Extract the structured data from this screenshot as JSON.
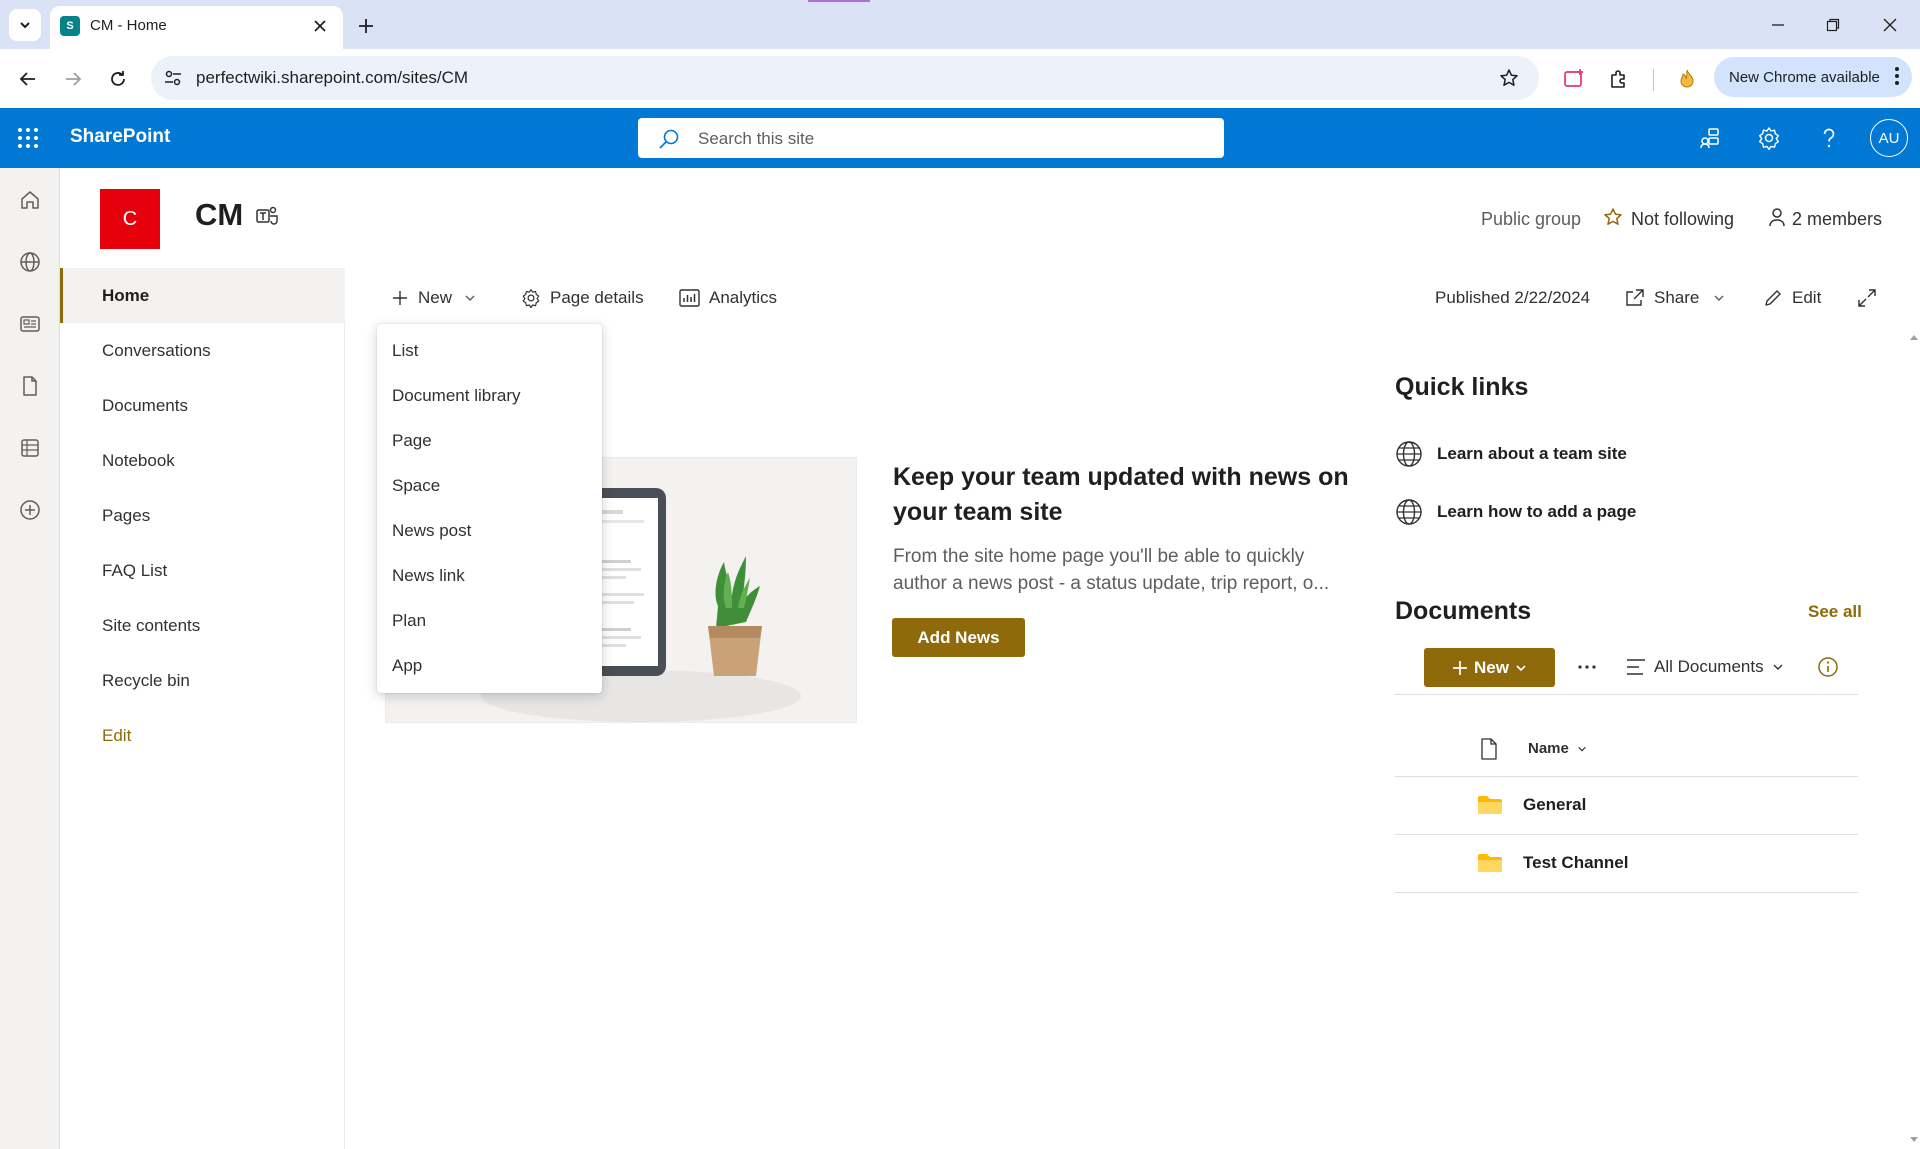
{
  "browser": {
    "tab_title": "CM - Home",
    "tab_favicon_letter": "S",
    "url": "perfectwiki.sharepoint.com/sites/CM",
    "update_label": "New Chrome available"
  },
  "suite": {
    "brand": "SharePoint",
    "search_placeholder": "Search this site",
    "avatar_initials": "AU"
  },
  "site": {
    "logo_letter": "C",
    "title": "CM",
    "group_type": "Public group",
    "follow_label": "Not following",
    "members_label": "2 members"
  },
  "leftnav": {
    "items": [
      {
        "label": "Home"
      },
      {
        "label": "Conversations"
      },
      {
        "label": "Documents"
      },
      {
        "label": "Notebook"
      },
      {
        "label": "Pages"
      },
      {
        "label": "FAQ List"
      },
      {
        "label": "Site contents"
      },
      {
        "label": "Recycle bin"
      }
    ],
    "edit_label": "Edit"
  },
  "commandbar": {
    "new_label": "New",
    "page_details_label": "Page details",
    "analytics_label": "Analytics",
    "published_label": "Published 2/22/2024",
    "share_label": "Share",
    "edit_label": "Edit"
  },
  "new_menu": {
    "items": [
      "List",
      "Document library",
      "Page",
      "Space",
      "News post",
      "News link",
      "Plan",
      "App"
    ]
  },
  "news": {
    "title": "Keep your team updated with news on your team site",
    "description_line1": "From the site home page you'll be able to quickly",
    "description_line2": "author a news post - a status update, trip report, o...",
    "button_label": "Add News"
  },
  "quick_links": {
    "title": "Quick links",
    "items": [
      "Learn about a team site",
      "Learn how to add a page"
    ]
  },
  "documents": {
    "title": "Documents",
    "see_all_label": "See all",
    "new_label": "New",
    "view_label": "All Documents",
    "column_name": "Name",
    "rows": [
      {
        "name": "General"
      },
      {
        "name": "Test Channel"
      }
    ]
  },
  "colors": {
    "suite_blue": "#0078d4",
    "theme_gold": "#8f6a0b",
    "logo_red": "#e5000b",
    "folder_yellow": "#ffb900"
  }
}
